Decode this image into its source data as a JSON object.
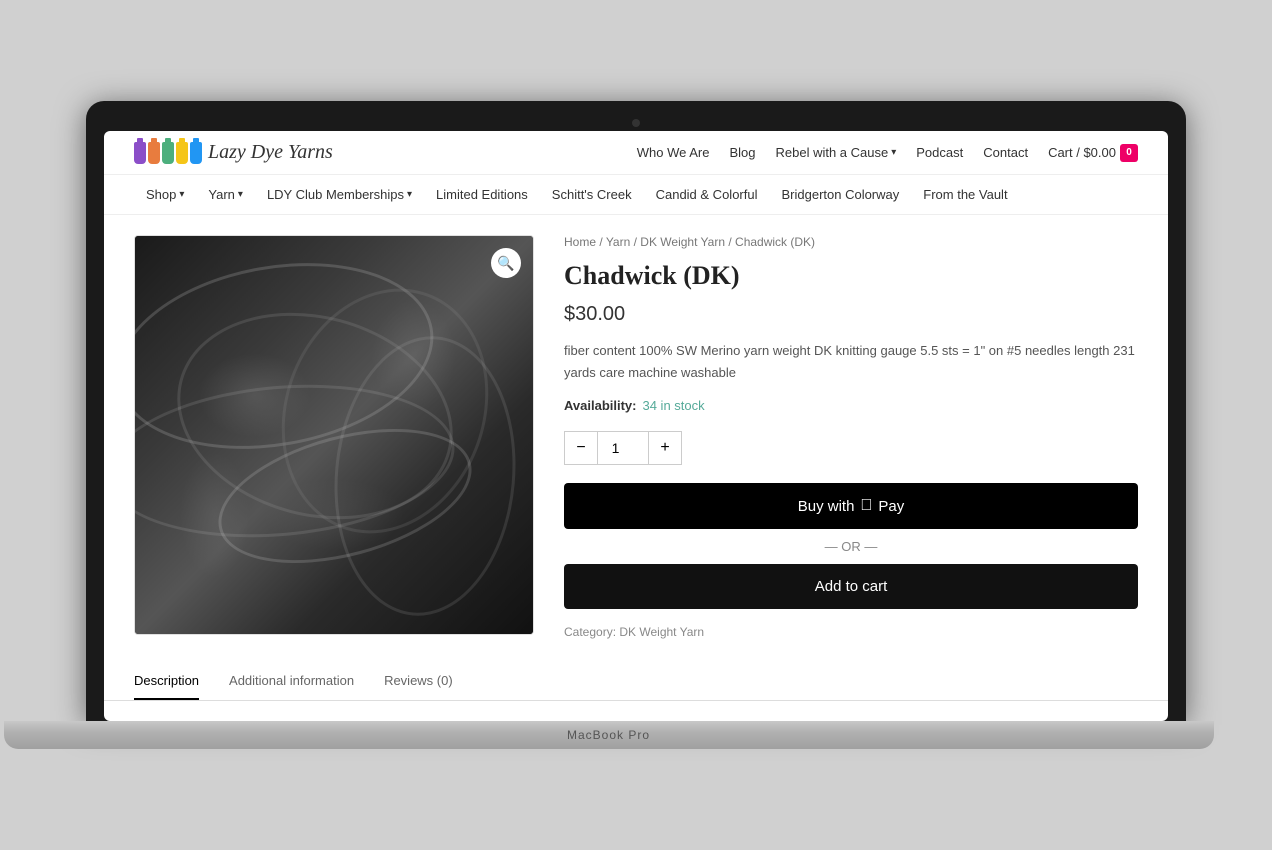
{
  "laptop": {
    "model_label": "MacBook Pro"
  },
  "site": {
    "logo_text": "Lazy Dye Yarns",
    "header": {
      "nav_items": [
        {
          "label": "Who We Are",
          "id": "who-we-are"
        },
        {
          "label": "Blog",
          "id": "blog"
        },
        {
          "label": "Rebel with a Cause",
          "id": "rebel-with-cause",
          "has_dropdown": true
        },
        {
          "label": "Podcast",
          "id": "podcast"
        },
        {
          "label": "Contact",
          "id": "contact"
        }
      ],
      "cart_label": "Cart / $0.00",
      "cart_count": "0"
    },
    "secondary_nav": [
      {
        "label": "Shop",
        "has_dropdown": true
      },
      {
        "label": "Yarn",
        "has_dropdown": true
      },
      {
        "label": "LDY Club Memberships",
        "has_dropdown": true
      },
      {
        "label": "Limited Editions"
      },
      {
        "label": "Schitt's Creek"
      },
      {
        "label": "Candid & Colorful"
      },
      {
        "label": "Bridgerton Colorway"
      },
      {
        "label": "From the Vault"
      }
    ],
    "product": {
      "breadcrumb": "Home / Yarn / DK Weight Yarn / Chadwick (DK)",
      "breadcrumb_parts": [
        "Home",
        "Yarn",
        "DK Weight Yarn",
        "Chadwick (DK)"
      ],
      "title": "Chadwick (DK)",
      "price": "$30.00",
      "description": "fiber content 100% SW Merino yarn weight DK knitting gauge 5.5 sts = 1\" on #5 needles length 231 yards care machine washable",
      "availability_label": "Availability:",
      "stock_text": "34 in stock",
      "quantity": "1",
      "buy_pay_label": "Buy with",
      "buy_pay_brand": "Pay",
      "or_text": "— OR —",
      "add_to_cart_label": "Add to cart",
      "category_label": "Category:",
      "category_value": "DK Weight Yarn"
    },
    "product_tabs": [
      {
        "label": "Description",
        "active": true
      },
      {
        "label": "Additional information"
      },
      {
        "label": "Reviews (0)"
      }
    ]
  }
}
